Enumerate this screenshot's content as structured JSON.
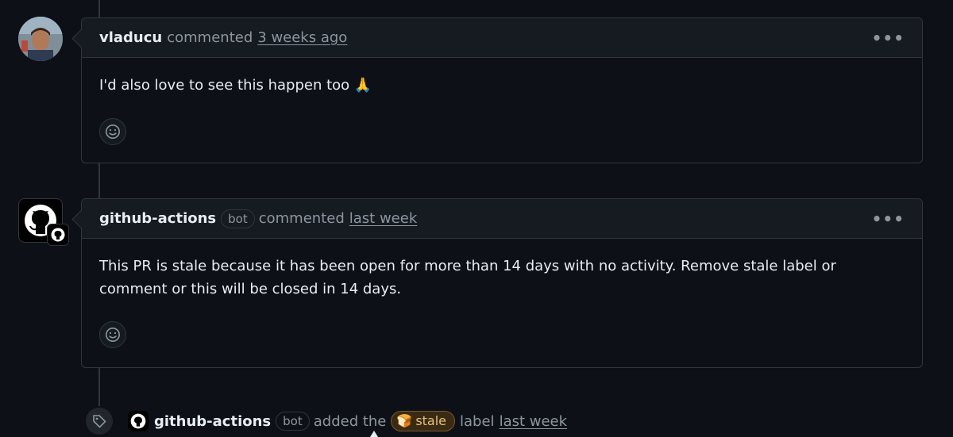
{
  "comments": [
    {
      "author": "vladucu",
      "action": "commented",
      "time": "3 weeks ago",
      "body": "I'd also love to see this happen too 🙏",
      "menu": "•••"
    },
    {
      "author": "github-actions",
      "bot_label": "bot",
      "action": "commented",
      "time": "last week",
      "body": "This PR is stale because it has been open for more than 14 days with no activity. Remove stale label or comment or this will be closed in 14 days.",
      "menu": "•••"
    }
  ],
  "event": {
    "actor": "github-actions",
    "bot_label": "bot",
    "action": "added the",
    "label_emoji": "🍞",
    "label_name": "stale",
    "suffix": "label",
    "time": "last week"
  },
  "colors": {
    "background": "#0d1117",
    "header": "#161b22",
    "border": "#30363d",
    "muted": "#8d96a0",
    "stale_label": "#e6c07b"
  },
  "icons": [
    "smiley-icon",
    "github-mark-icon",
    "tag-icon",
    "kebab-menu-icon"
  ]
}
